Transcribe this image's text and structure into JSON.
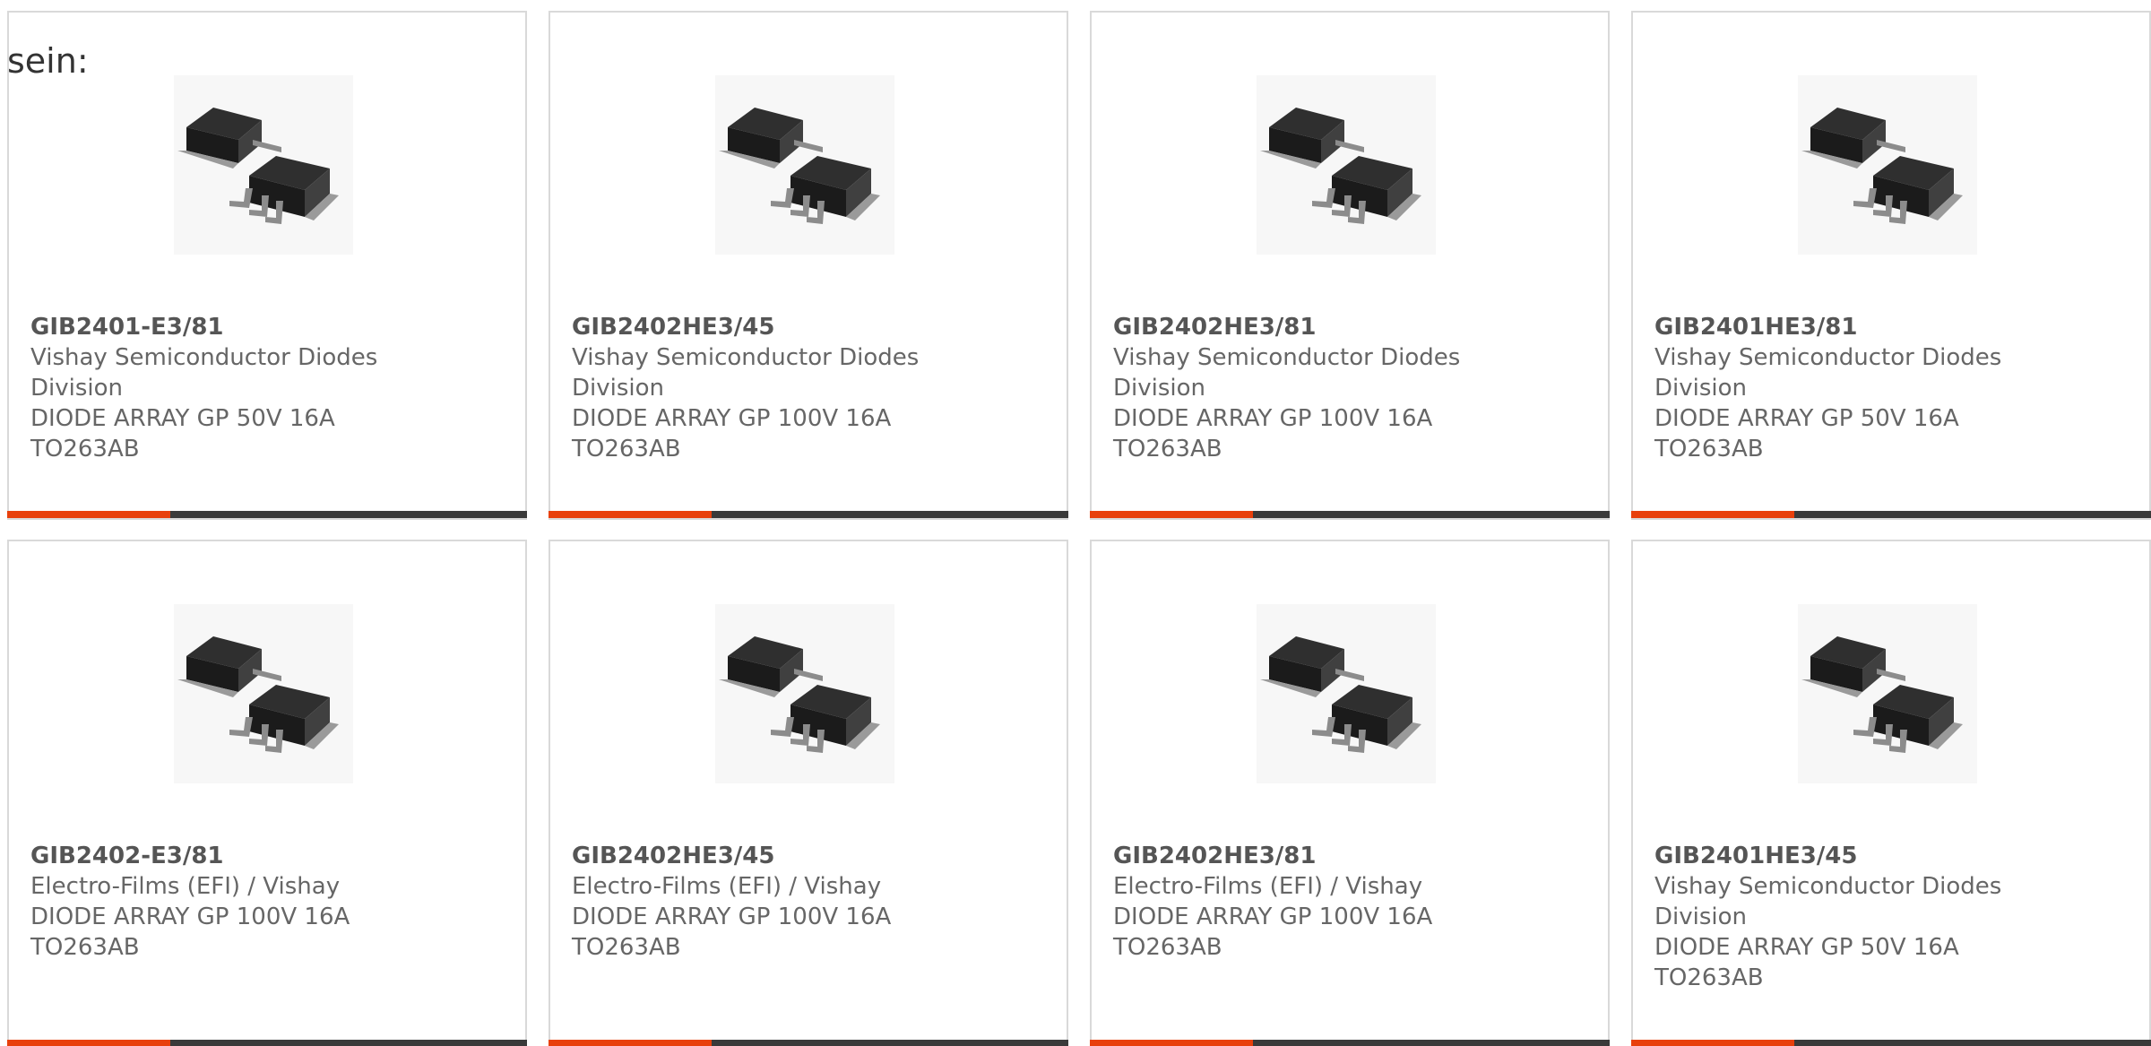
{
  "intro_text": "sein:",
  "colors": {
    "accent": "#e8400c",
    "bar": "#3a3a3a",
    "border": "#d9d9d9",
    "text": "#666666"
  },
  "products": [
    {
      "part_number": "GIB2401-E3/81",
      "manufacturer": "Vishay Semiconductor Diodes Division",
      "description": "DIODE ARRAY GP 50V 16A TO263AB",
      "image_icon": "to263ab-package-image"
    },
    {
      "part_number": "GIB2402HE3/45",
      "manufacturer": "Vishay Semiconductor Diodes Division",
      "description": "DIODE ARRAY GP 100V 16A TO263AB",
      "image_icon": "to263ab-package-image"
    },
    {
      "part_number": "GIB2402HE3/81",
      "manufacturer": "Vishay Semiconductor Diodes Division",
      "description": "DIODE ARRAY GP 100V 16A TO263AB",
      "image_icon": "to263ab-package-image"
    },
    {
      "part_number": "GIB2401HE3/81",
      "manufacturer": "Vishay Semiconductor Diodes Division",
      "description": "DIODE ARRAY GP 50V 16A TO263AB",
      "image_icon": "to263ab-package-image"
    },
    {
      "part_number": "GIB2402-E3/81",
      "manufacturer": "Electro-Films (EFI) / Vishay",
      "description": "DIODE ARRAY GP 100V 16A TO263AB",
      "image_icon": "to263ab-package-image"
    },
    {
      "part_number": "GIB2402HE3/45",
      "manufacturer": "Electro-Films (EFI) / Vishay",
      "description": "DIODE ARRAY GP 100V 16A TO263AB",
      "image_icon": "to263ab-package-image"
    },
    {
      "part_number": "GIB2402HE3/81",
      "manufacturer": "Electro-Films (EFI) / Vishay",
      "description": "DIODE ARRAY GP 100V 16A TO263AB",
      "image_icon": "to263ab-package-image"
    },
    {
      "part_number": "GIB2401HE3/45",
      "manufacturer": "Vishay Semiconductor Diodes Division",
      "description": "DIODE ARRAY GP 50V 16A TO263AB",
      "image_icon": "to263ab-package-image"
    }
  ]
}
